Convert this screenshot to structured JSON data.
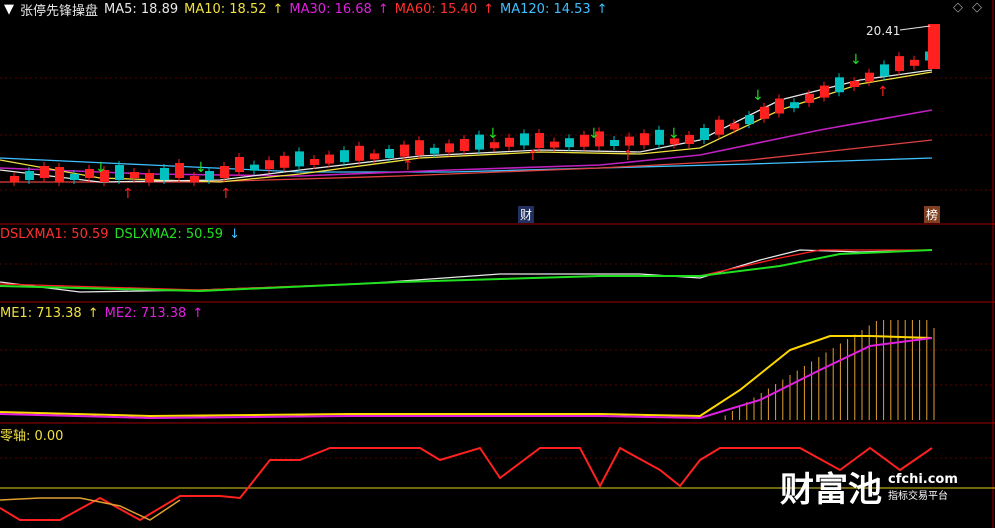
{
  "colors": {
    "bg": "#000000",
    "red": "#ff2020",
    "cyan": "#00c0c0",
    "white": "#e8e8e8",
    "yellow": "#ffd700",
    "magenta": "#e020e0",
    "green": "#20e020",
    "ma120": "#40c0ff",
    "ma60": "#e04040",
    "ma30": "#c020c0",
    "ma10": "#f0e040"
  },
  "header": {
    "stock_name": "张停先锋操盘",
    "ma5_label": "MA5: 18.89",
    "ma10_label": "MA10: 18.52",
    "ma30_label": "MA30: 16.68",
    "ma60_label": "MA60: 15.40",
    "ma120_label": "MA120: 14.53",
    "price_peak": "20.41",
    "tag_cai": "财",
    "tag_bang": "榜"
  },
  "panel2": {
    "dslxma1_label": "DSLXMA1: 50.59",
    "dslxma2_label": "DSLXMA2: 50.59"
  },
  "panel3": {
    "me1_label": "ME1: 713.38",
    "me2_label": "ME2: 713.38"
  },
  "panel4": {
    "zero_axis_label": "零轴: 0.00"
  },
  "watermark": {
    "brand": "财富池",
    "domain": "cfchi.com",
    "tagline": "指标交易平台"
  },
  "chart_data": [
    {
      "type": "line",
      "panel": "main",
      "title": "张停先锋操盘",
      "note": "candlestick price panel with moving averages",
      "series": [
        {
          "name": "MA5",
          "last": 18.89
        },
        {
          "name": "MA10",
          "last": 18.52
        },
        {
          "name": "MA30",
          "last": 16.68
        },
        {
          "name": "MA60",
          "last": 15.4
        },
        {
          "name": "MA120",
          "last": 14.53
        }
      ],
      "annotations": [
        "20.41"
      ]
    },
    {
      "type": "line",
      "panel": "dslxma",
      "series": [
        {
          "name": "DSLXMA1",
          "last": 50.59
        },
        {
          "name": "DSLXMA2",
          "last": 50.59
        }
      ]
    },
    {
      "type": "line",
      "panel": "me",
      "series": [
        {
          "name": "ME1",
          "last": 713.38
        },
        {
          "name": "ME2",
          "last": 713.38
        }
      ]
    },
    {
      "type": "line",
      "panel": "zero-axis",
      "series": [
        {
          "name": "零轴",
          "last": 0.0
        }
      ]
    }
  ]
}
